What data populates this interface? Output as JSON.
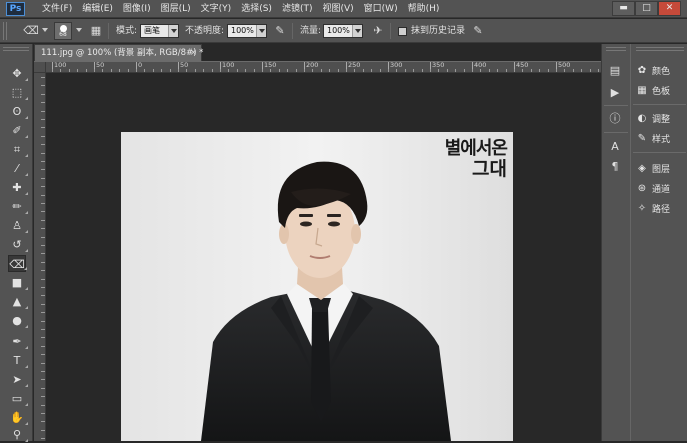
{
  "app": {
    "logo": "Ps",
    "menus": [
      "文件(F)",
      "编辑(E)",
      "图像(I)",
      "图层(L)",
      "文字(Y)",
      "选择(S)",
      "滤镜(T)",
      "视图(V)",
      "窗口(W)",
      "帮助(H)"
    ],
    "window_buttons": {
      "minimize": "▬",
      "maximize": "□",
      "close": "✕"
    }
  },
  "options": {
    "tool_icon": "eraser-icon",
    "brush_size": "68",
    "mode_label": "模式:",
    "mode_value": "画笔",
    "opacity_label": "不透明度:",
    "opacity_value": "100%",
    "flow_label": "流量:",
    "flow_value": "100%",
    "history_label": "抹到历史记录"
  },
  "document": {
    "tab_title": "111.jpg @ 100% (背景 副本, RGB/8#) *",
    "close_glyph": "×",
    "ruler_labels": [
      "100",
      "50",
      "0",
      "50",
      "100",
      "150",
      "200",
      "250",
      "300",
      "350",
      "400",
      "450",
      "500"
    ],
    "image_text_line1": "별에서온",
    "image_text_line2": "그대"
  },
  "tools": [
    "move-icon",
    "marquee-icon",
    "lasso-icon",
    "quick-select-icon",
    "eyedropper-icon",
    "healing-icon",
    "brush-icon",
    "stamp-icon",
    "history-brush-icon",
    "eraser-icon",
    "gradient-icon",
    "blur-icon",
    "dodge-icon",
    "pen-icon",
    "type-icon",
    "path-select-icon",
    "shape-icon",
    "hand-icon",
    "zoom-icon"
  ],
  "panels": {
    "items": [
      {
        "label": "颜色",
        "icon": "color-icon"
      },
      {
        "label": "色板",
        "icon": "swatches-icon"
      },
      {
        "label": "调整",
        "icon": "adjustments-icon"
      },
      {
        "label": "样式",
        "icon": "styles-icon"
      },
      {
        "label": "图层",
        "icon": "layers-icon"
      },
      {
        "label": "通道",
        "icon": "channels-icon"
      },
      {
        "label": "路径",
        "icon": "paths-icon"
      }
    ]
  }
}
